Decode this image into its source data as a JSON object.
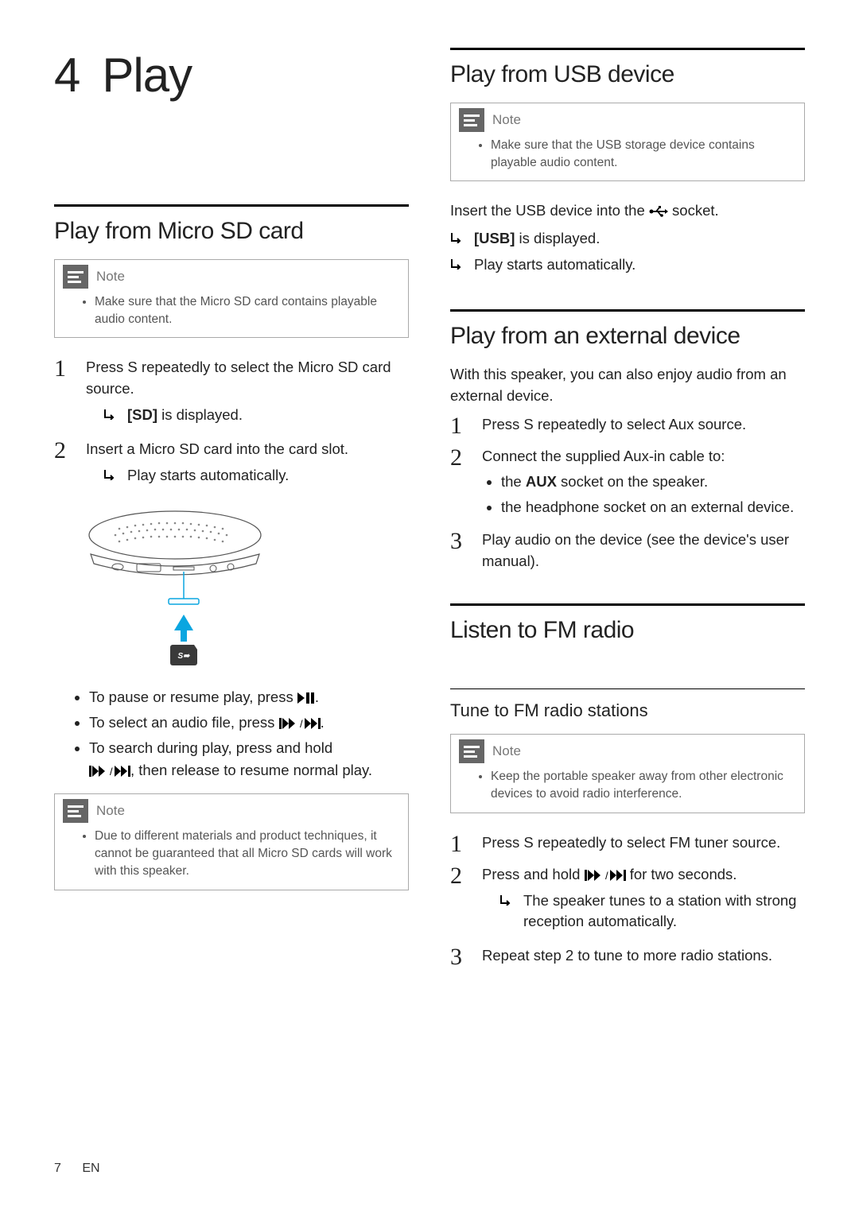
{
  "chapter": {
    "num": "4",
    "title": "Play"
  },
  "left": {
    "sect1": {
      "title": "Play from Micro SD card",
      "note_label": "Note",
      "note_item": "Make sure that the Micro SD card contains playable audio content.",
      "step1": "Press S repeatedly to select the Micro SD card source.",
      "step1_result_pre": "",
      "step1_result_key": "[SD]",
      "step1_result_post": " is displayed.",
      "step2": "Insert a Micro SD card into the card slot.",
      "step2_result": "Play starts automatically.",
      "tip1_pre": "To pause or resume play, press ",
      "tip1_post": ".",
      "tip2_pre": "To select an audio file, press ",
      "tip2_post": ".",
      "tip3_pre": "To search during play, press and hold ",
      "tip3_mid": ", then release to resume normal play.",
      "note2_label": "Note",
      "note2_item": "Due to different materials and product techniques, it cannot be guaranteed that all Micro SD cards will work with this speaker."
    }
  },
  "right": {
    "usb": {
      "title": "Play from USB device",
      "note_label": "Note",
      "note_item": "Make sure that the USB storage device contains playable audio content.",
      "intro_pre": "Insert the USB device into the ",
      "intro_post": " socket.",
      "r1_key": "[USB]",
      "r1_post": " is displayed.",
      "r2": "Play starts automatically."
    },
    "ext": {
      "title": "Play from an external device",
      "intro": "With this speaker, you can also enjoy audio from an external device.",
      "s1": "Press S repeatedly to select Aux source.",
      "s2": "Connect the supplied Aux-in cable to:",
      "s2_b1_pre": "the ",
      "s2_b1_key": "AUX",
      "s2_b1_post": " socket on the speaker.",
      "s2_b2": "the headphone socket on an external device.",
      "s3": "Play audio on the device (see the device's user manual)."
    },
    "fm": {
      "title": "Listen to FM radio",
      "sub": "Tune to FM radio stations",
      "note_label": "Note",
      "note_item": "Keep the portable speaker away from other electronic devices to avoid radio interference.",
      "s1": "Press S repeatedly to select FM tuner source.",
      "s2_pre": "Press and hold ",
      "s2_post": " for two seconds.",
      "s2_r": "The speaker tunes to a station with strong reception automatically.",
      "s3": "Repeat step 2 to tune to more radio stations."
    }
  },
  "footer": {
    "page": "7",
    "lang": "EN"
  }
}
